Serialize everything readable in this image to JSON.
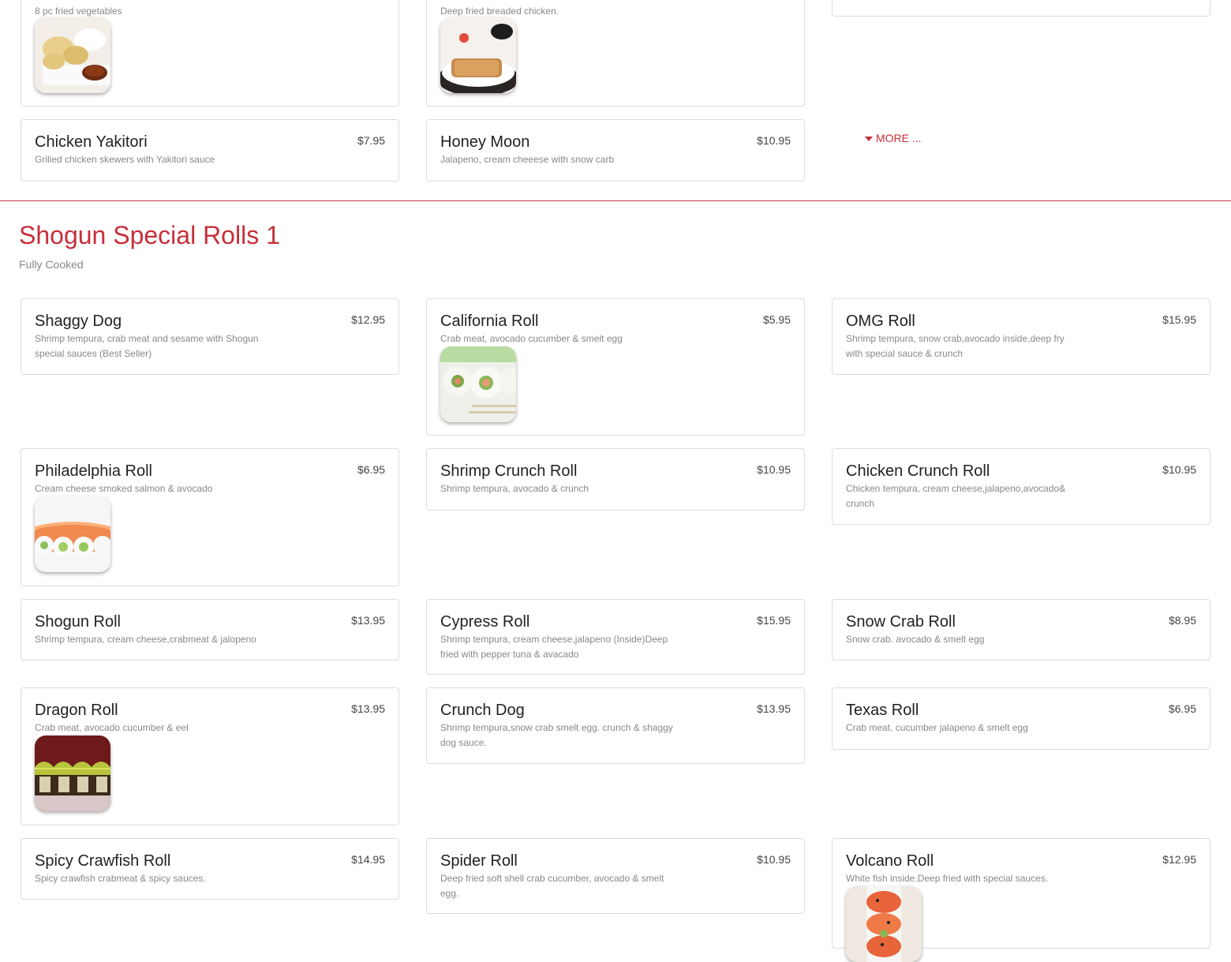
{
  "top": {
    "vegetable_tempura": {
      "desc": "8 pc fried vegetables"
    },
    "chicken_katsu": {
      "desc": "Deep fried breaded chicken."
    },
    "chicken_yakitori": {
      "name": "Chicken Yakitori",
      "price": "$7.95",
      "desc": "Grilled chicken skewers with Yakitori sauce"
    },
    "honey_moon": {
      "name": "Honey Moon",
      "price": "$10.95",
      "desc": "Jalapeno, cream cheeese with snow carb"
    },
    "more_label": "MORE ..."
  },
  "section": {
    "title": "Shogun Special Rolls 1",
    "subtitle": "Fully Cooked",
    "items": [
      {
        "name": "Shaggy Dog",
        "price": "$12.95",
        "desc": "Shrimp tempura, crab meat and sesame with Shogun special sauces (Best Seller)"
      },
      {
        "name": "California Roll",
        "price": "$5.95",
        "desc": "Crab meat, avocado cucumber & smelt egg"
      },
      {
        "name": "OMG Roll",
        "price": "$15.95",
        "desc": "Shrimp tempura, snow crab,avocado inside,deep fry with special sauce & crunch"
      },
      {
        "name": "Philadelphia Roll",
        "price": "$6.95",
        "desc": "Cream cheese smoked salmon & avocado"
      },
      {
        "name": "Shrimp Crunch Roll",
        "price": "$10.95",
        "desc": "Shrimp tempura, avocado & crunch"
      },
      {
        "name": "Chicken Crunch Roll",
        "price": "$10.95",
        "desc": "Chicken tempura, cream cheese,jalapeno,avocado& crunch"
      },
      {
        "name": "Shogun Roll",
        "price": "$13.95",
        "desc": "Shrimp tempura, cream cheese,crabmeat & jalopeno"
      },
      {
        "name": "Cypress Roll",
        "price": "$15.95",
        "desc": "Shrimp tempura, cream cheese,jalapeno (Inside)Deep fried with pepper tuna & avacado"
      },
      {
        "name": "Snow Crab Roll",
        "price": "$8.95",
        "desc": "Snow crab. avocado & smelt egg"
      },
      {
        "name": "Dragon Roll",
        "price": "$13.95",
        "desc": "Crab meat, avocado cucumber & eel"
      },
      {
        "name": "Crunch Dog",
        "price": "$13.95",
        "desc": "Shrimp tempura,snow crab smelt egg. crunch & shaggy dog sauce."
      },
      {
        "name": "Texas Roll",
        "price": "$6.95",
        "desc": "Crab meat. cucumber jalapeno & smelt egg"
      },
      {
        "name": "Spicy Crawfish Roll",
        "price": "$14.95",
        "desc": "Spicy crawfish crabmeat & spicy sauces."
      },
      {
        "name": "Spider Roll",
        "price": "$10.95",
        "desc": "Deep fried soft shell crab cucumber, avocado & smelt egg."
      },
      {
        "name": "Volcano Roll",
        "price": "$12.95",
        "desc": "White fish inside.Deep fried with special sauces."
      }
    ]
  }
}
